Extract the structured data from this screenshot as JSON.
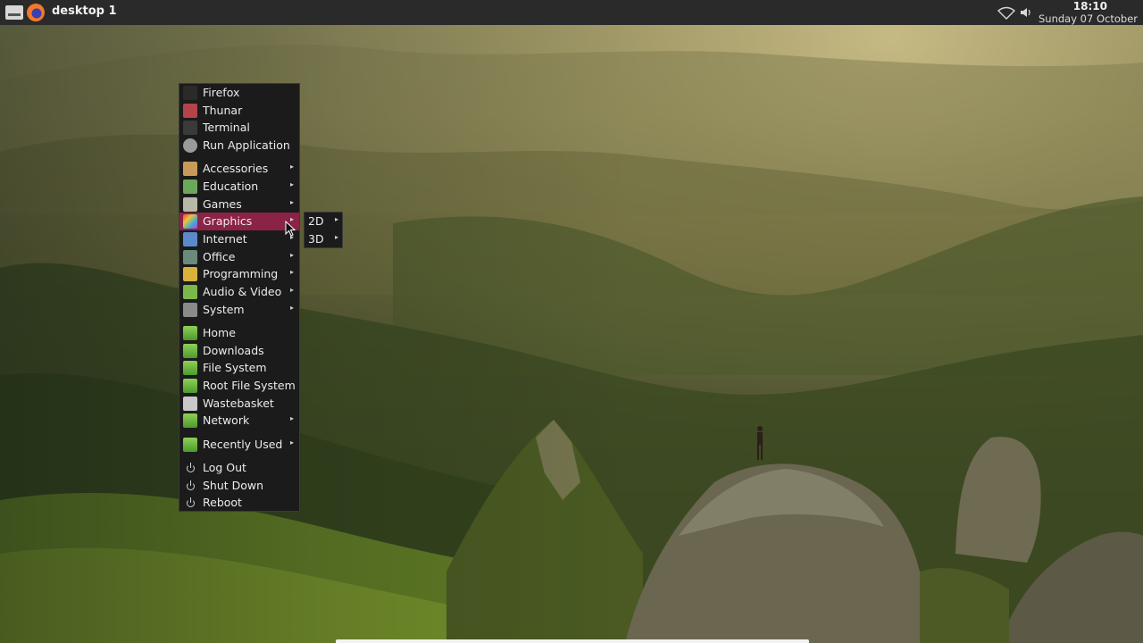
{
  "panel": {
    "desktop_label": "desktop 1",
    "time": "18:10",
    "date": "Sunday 07 October",
    "icons": [
      "menu-icon",
      "firefox-icon",
      "wifi-icon",
      "volume-icon"
    ]
  },
  "menu": {
    "apps": [
      {
        "label": "Firefox",
        "icon": "firefox-icon",
        "color": "#2a2a2a"
      },
      {
        "label": "Thunar",
        "icon": "file-manager-icon",
        "color": "#b4434a"
      },
      {
        "label": "Terminal",
        "icon": "terminal-icon",
        "color": "#3a3a3a"
      },
      {
        "label": "Run Application",
        "icon": "gear-icon",
        "color": "#9a9a9a"
      }
    ],
    "categories": [
      {
        "label": "Accessories",
        "icon": "accessories-icon",
        "color": "#c89a5a"
      },
      {
        "label": "Education",
        "icon": "education-icon",
        "color": "#6aa95a"
      },
      {
        "label": "Games",
        "icon": "games-icon",
        "color": "#b8b8a8"
      },
      {
        "label": "Graphics",
        "icon": "graphics-icon",
        "color": "#d84a8a"
      },
      {
        "label": "Internet",
        "icon": "internet-icon",
        "color": "#5a8acb"
      },
      {
        "label": "Office",
        "icon": "office-icon",
        "color": "#6a8a7a"
      },
      {
        "label": "Programming",
        "icon": "programming-icon",
        "color": "#d8b23a"
      },
      {
        "label": "Audio & Video",
        "icon": "audio-video-icon",
        "color": "#7ab84a"
      },
      {
        "label": "System",
        "icon": "system-icon",
        "color": "#8a8a8a"
      }
    ],
    "places": [
      {
        "label": "Home",
        "icon": "folder-icon",
        "arrow": false
      },
      {
        "label": "Downloads",
        "icon": "folder-icon",
        "arrow": false
      },
      {
        "label": "File System",
        "icon": "folder-icon",
        "arrow": false
      },
      {
        "label": "Root File System",
        "icon": "folder-icon",
        "arrow": false
      },
      {
        "label": "Wastebasket",
        "icon": "trash-icon",
        "arrow": false
      },
      {
        "label": "Network",
        "icon": "folder-icon",
        "arrow": true
      }
    ],
    "recent": {
      "label": "Recently Used",
      "icon": "folder-icon"
    },
    "session": [
      {
        "label": "Log Out",
        "icon": "power-icon"
      },
      {
        "label": "Shut Down",
        "icon": "power-icon"
      },
      {
        "label": "Reboot",
        "icon": "power-icon"
      }
    ],
    "highlight_color": "#8a2346"
  },
  "submenu": {
    "items": [
      {
        "label": "2D"
      },
      {
        "label": "3D"
      }
    ]
  }
}
